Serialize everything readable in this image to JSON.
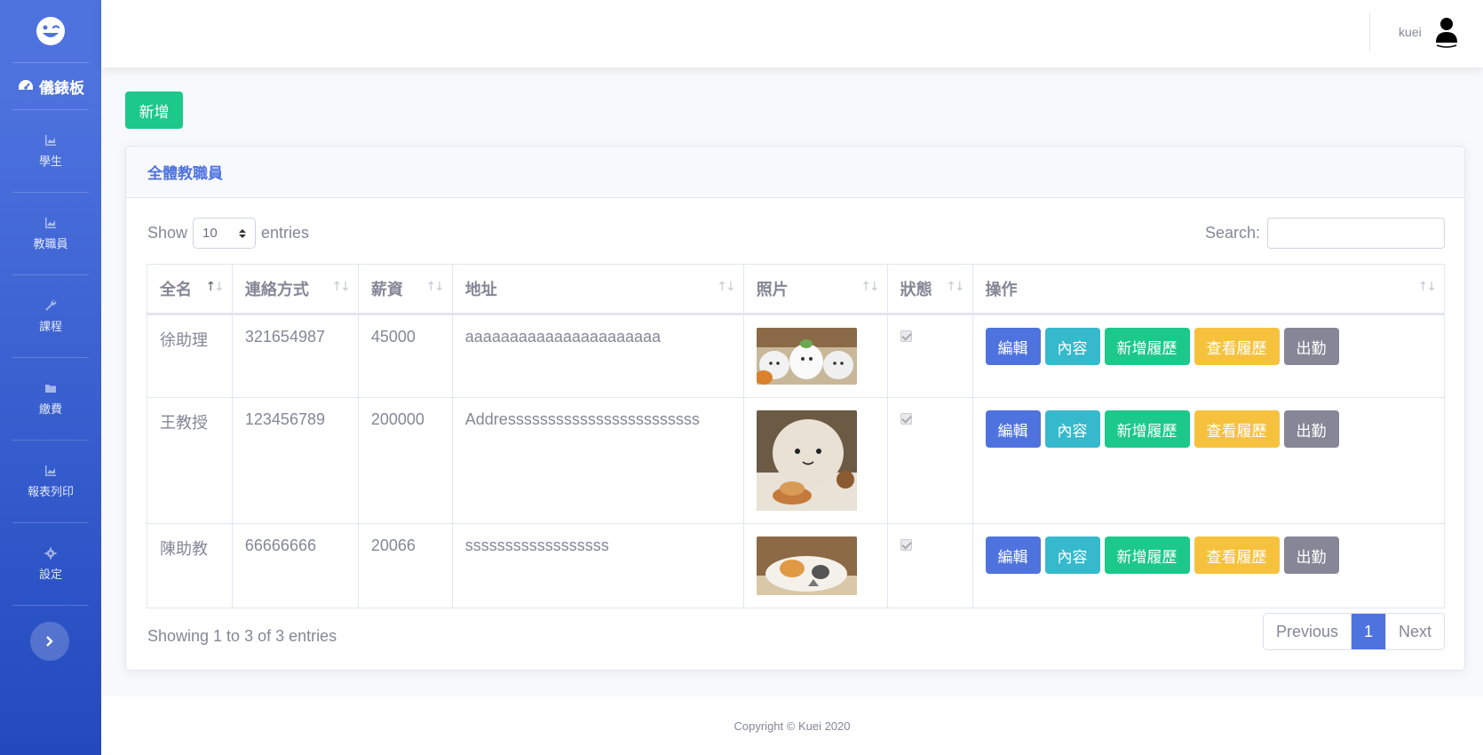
{
  "sidebar": {
    "brand_icon": "grin-wink-icon",
    "dashboard_label": "儀錶板",
    "items": [
      {
        "label": "學生",
        "icon": "chart-area-icon"
      },
      {
        "label": "教職員",
        "icon": "chart-area-icon"
      },
      {
        "label": "課程",
        "icon": "wrench-icon"
      },
      {
        "label": "繳費",
        "icon": "folder-icon"
      },
      {
        "label": "報表列印",
        "icon": "chart-area-icon"
      },
      {
        "label": "設定",
        "icon": "cog-icon"
      }
    ],
    "toggle_icon": "chevron-right-icon"
  },
  "topbar": {
    "user_name": "kuei",
    "avatar_icon": "user-icon"
  },
  "add_button_label": "新增",
  "card": {
    "title": "全體教職員",
    "show_label": "Show",
    "page_size": "10",
    "entries_label": "entries",
    "search_label": "Search:",
    "search_value": ""
  },
  "table": {
    "columns": [
      "全名",
      "連絡方式",
      "薪資",
      "地址",
      "照片",
      "狀態",
      "操作"
    ],
    "rows": [
      {
        "name": "徐助理",
        "contact": "321654987",
        "salary": "45000",
        "address": "aaaaaaaaaaaaaaaaaaaaaa",
        "photo": "cat-photo-1",
        "status": true
      },
      {
        "name": "王教授",
        "contact": "123456789",
        "salary": "200000",
        "address": "Addressssssssssssssssssssssss",
        "photo": "plush-photo-2",
        "status": true
      },
      {
        "name": "陳助教",
        "contact": "66666666",
        "salary": "20066",
        "address": "ssssssssssssssssss",
        "photo": "cat-photo-3",
        "status": true
      }
    ],
    "action_labels": {
      "edit": "編輯",
      "detail": "內容",
      "add_resume": "新增履歷",
      "view_resume": "查看履歷",
      "attendance": "出勤"
    }
  },
  "info_text": "Showing 1 to 3 of 3 entries",
  "pagination": {
    "previous": "Previous",
    "current": "1",
    "next": "Next"
  },
  "footer": "Copyright © Kuei 2020",
  "colors": {
    "primary": "#4e73df",
    "info": "#36b9cc",
    "success": "#1cc88a",
    "warning": "#f6c23e",
    "secondary": "#858796"
  }
}
